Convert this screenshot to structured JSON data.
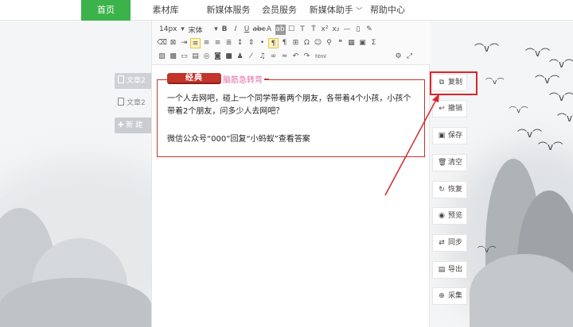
{
  "nav": {
    "items": [
      "首页",
      "素材库",
      "新媒体服务",
      "会员服务",
      "新媒体助手",
      "帮助中心"
    ],
    "active": 0
  },
  "docs": {
    "items": [
      "文章2",
      "文章2"
    ],
    "new_button": "新 建"
  },
  "toolbar": {
    "font_size": "14px",
    "font_family": "宋体"
  },
  "article": {
    "badge": "经典",
    "subtitle": "脑筋急转弯",
    "paragraph1": "一个人去网吧，碰上一个同学带着两个朋友，各带着4个小孩，小孩个带着2个朋友，问多少人去网吧？",
    "paragraph2": "微信公众号“000”回复“小蚂蚁”查看答案"
  },
  "actions": [
    {
      "icon": "copy-icon",
      "label": "复制"
    },
    {
      "icon": "undo-icon",
      "label": "撤销"
    },
    {
      "icon": "save-icon",
      "label": "保存"
    },
    {
      "icon": "trash-icon",
      "label": "清空"
    },
    {
      "icon": "restore-icon",
      "label": "恢复"
    },
    {
      "icon": "eye-icon",
      "label": "预览"
    },
    {
      "icon": "sync-icon",
      "label": "同步"
    },
    {
      "icon": "export-icon",
      "label": "导出"
    },
    {
      "icon": "collect-icon",
      "label": "采集"
    }
  ],
  "colors": {
    "nav_active": "#3bb34a",
    "badge": "#c3342b",
    "subtitle": "#e06aa8",
    "highlight": "#d9262c"
  }
}
